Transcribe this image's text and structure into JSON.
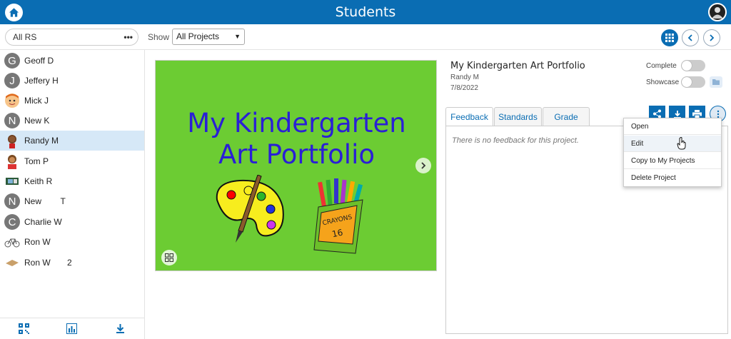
{
  "header": {
    "title": "Students"
  },
  "toolbar": {
    "filter_value": "All RS",
    "show_label": "Show",
    "project_select": "All Projects"
  },
  "students": [
    {
      "name": "Geoff D",
      "initial": "G",
      "avatar": "letter"
    },
    {
      "name": "Jeffery H",
      "initial": "J",
      "avatar": "letter"
    },
    {
      "name": "Mick J",
      "initial": "",
      "avatar": "cartoon-face"
    },
    {
      "name": "New K",
      "initial": "N",
      "avatar": "letter"
    },
    {
      "name": "Randy M",
      "initial": "",
      "avatar": "cartoon-character",
      "selected": true
    },
    {
      "name": "Tom P",
      "initial": "",
      "avatar": "cartoon-boy"
    },
    {
      "name": "Keith R",
      "initial": "",
      "avatar": "photo"
    },
    {
      "name": "New        T",
      "initial": "N",
      "avatar": "letter"
    },
    {
      "name": "Charlie W",
      "initial": "C",
      "avatar": "letter"
    },
    {
      "name": "Ron W",
      "initial": "",
      "avatar": "bicycle"
    },
    {
      "name": "Ron W       2",
      "initial": "",
      "avatar": "ruler"
    }
  ],
  "sidebar_footer_icons": [
    "qr-code-icon",
    "bar-chart-icon",
    "download-icon"
  ],
  "slide": {
    "title_line1": "My Kindergarten",
    "title_line2": "Art Portfolio",
    "crayon_box_text_1": "CRAYONS",
    "crayon_box_text_2": "16"
  },
  "project": {
    "title": "My Kindergarten Art Portfolio",
    "student": "Randy M",
    "date": "7/8/2022",
    "complete_label": "Complete",
    "showcase_label": "Showcase"
  },
  "tabs": [
    "Feedback",
    "Standards",
    "Grade"
  ],
  "feedback_text": "There is no feedback for this project.",
  "context_menu": [
    "Open",
    "Edit",
    "Copy to My Projects",
    "Delete Project"
  ],
  "colors": {
    "brand": "#0a6db3",
    "slide_bg": "#6ccc33",
    "slide_text": "#2a1fd6"
  }
}
